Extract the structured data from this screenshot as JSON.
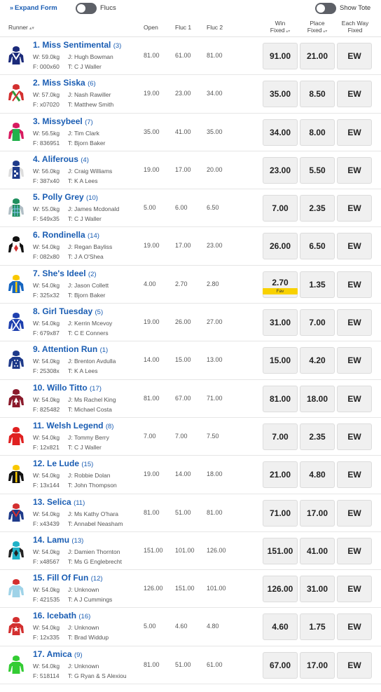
{
  "toolbar": {
    "expand_form_label": "Expand Form",
    "flucs_label": "Flucs",
    "show_tote_label": "Show Tote"
  },
  "headers": {
    "runner": "Runner",
    "open": "Open",
    "fluc1": "Fluc 1",
    "fluc2": "Fluc 2",
    "win_line1": "Win",
    "win_line2": "Fixed",
    "place_line1": "Place",
    "place_line2": "Fixed",
    "ew_line1": "Each Way",
    "ew_line2": "Fixed"
  },
  "runners": [
    {
      "name": "1. Miss Sentimental",
      "barrier": "(3)",
      "weight": "W: 59.0kg",
      "jockey": "J: Hugh Bowman",
      "form": "F: 000x60",
      "trainer": "T: C J Waller",
      "open": "81.00",
      "fluc1": "61.00",
      "fluc2": "81.00",
      "win": "91.00",
      "place": "21.00",
      "ew": "EW",
      "fav": "",
      "silk": {
        "body": "#1b2a7a",
        "sleeve": "#1b2a7a",
        "cap": "#1b2a7a",
        "accent": "#ffffff",
        "pattern": "v"
      }
    },
    {
      "name": "2. Miss Siska",
      "barrier": "(6)",
      "weight": "W: 57.0kg",
      "jockey": "J: Nash Rawiller",
      "form": "F: x07020",
      "trainer": "T: Matthew Smith",
      "open": "19.00",
      "fluc1": "23.00",
      "fluc2": "34.00",
      "win": "35.00",
      "place": "8.50",
      "ew": "EW",
      "fav": "",
      "silk": {
        "body": "#ffffff",
        "sleeve": "#d32f2f",
        "cap": "#d32f2f",
        "accent": "#2e9b3a",
        "pattern": "sash"
      }
    },
    {
      "name": "3. Missybeel",
      "barrier": "(7)",
      "weight": "W: 56.5kg",
      "jockey": "J: Tim Clark",
      "form": "F: 836951",
      "trainer": "T: Bjorn Baker",
      "open": "35.00",
      "fluc1": "41.00",
      "fluc2": "35.00",
      "win": "34.00",
      "place": "8.00",
      "ew": "EW",
      "fav": "",
      "silk": {
        "body": "#22b14c",
        "sleeve": "#d81b60",
        "cap": "#d81b60",
        "accent": "#22b14c",
        "pattern": "plain"
      }
    },
    {
      "name": "4. Aliferous",
      "barrier": "(4)",
      "weight": "W: 56.0kg",
      "jockey": "J: Craig Williams",
      "form": "F: 387x40",
      "trainer": "T: K A Lees",
      "open": "19.00",
      "fluc1": "17.00",
      "fluc2": "20.00",
      "win": "23.00",
      "place": "5.50",
      "ew": "EW",
      "fav": "",
      "silk": {
        "body": "#1e3a8a",
        "sleeve": "#dddddd",
        "cap": "#1e3a8a",
        "accent": "#ffffff",
        "pattern": "check"
      }
    },
    {
      "name": "5. Polly Grey",
      "barrier": "(10)",
      "weight": "W: 55.0kg",
      "jockey": "J: James Mcdonald",
      "form": "F: 549x35",
      "trainer": "T: C J Waller",
      "open": "5.00",
      "fluc1": "6.00",
      "fluc2": "6.50",
      "win": "7.00",
      "place": "2.35",
      "ew": "EW",
      "fav": "",
      "silk": {
        "body": "#1f8f5f",
        "sleeve": "#b0bec5",
        "cap": "#1f8f5f",
        "accent": "#90caf9",
        "pattern": "tartan"
      }
    },
    {
      "name": "6. Rondinella",
      "barrier": "(14)",
      "weight": "W: 54.0kg",
      "jockey": "J: Regan Bayliss",
      "form": "F: 082x80",
      "trainer": "T: J A O'Shea",
      "open": "19.00",
      "fluc1": "17.00",
      "fluc2": "23.00",
      "win": "26.00",
      "place": "6.50",
      "ew": "EW",
      "fav": "",
      "silk": {
        "body": "#ffffff",
        "sleeve": "#111111",
        "cap": "#111111",
        "accent": "#d32f2f",
        "pattern": "diamond"
      }
    },
    {
      "name": "7. She's Ideel",
      "barrier": "(2)",
      "weight": "W: 54.0kg",
      "jockey": "J: Jason Collett",
      "form": "F: 325x32",
      "trainer": "T: Bjorn Baker",
      "open": "4.00",
      "fluc1": "2.70",
      "fluc2": "2.80",
      "win": "2.70",
      "place": "1.35",
      "ew": "EW",
      "fav": "Fav",
      "silk": {
        "body": "#1565c0",
        "sleeve": "#1565c0",
        "cap": "#f9c800",
        "accent": "#f9c800",
        "pattern": "stripe"
      }
    },
    {
      "name": "8. Girl Tuesday",
      "barrier": "(5)",
      "weight": "W: 54.0kg",
      "jockey": "J: Kerrin Mcevoy",
      "form": "F: 679x87",
      "trainer": "T: C E Conners",
      "open": "19.00",
      "fluc1": "26.00",
      "fluc2": "27.00",
      "win": "31.00",
      "place": "7.00",
      "ew": "EW",
      "fav": "",
      "silk": {
        "body": "#1e40af",
        "sleeve": "#1e40af",
        "cap": "#1e40af",
        "accent": "#ffffff",
        "pattern": "cross"
      }
    },
    {
      "name": "9. Attention Run",
      "barrier": "(1)",
      "weight": "W: 54.0kg",
      "jockey": "J: Brenton Avdulla",
      "form": "F: 25308x",
      "trainer": "T: K A Lees",
      "open": "14.00",
      "fluc1": "15.00",
      "fluc2": "13.00",
      "win": "15.00",
      "place": "4.20",
      "ew": "EW",
      "fav": "",
      "silk": {
        "body": "#1e3a8a",
        "sleeve": "#1e3a8a",
        "cap": "#1e3a8a",
        "accent": "#ffffff",
        "pattern": "dots"
      }
    },
    {
      "name": "10. Willo Titto",
      "barrier": "(17)",
      "weight": "W: 54.0kg",
      "jockey": "J: Ms Rachel King",
      "form": "F: 825482",
      "trainer": "T: Michael Costa",
      "open": "81.00",
      "fluc1": "67.00",
      "fluc2": "71.00",
      "win": "81.00",
      "place": "18.00",
      "ew": "EW",
      "fav": "",
      "silk": {
        "body": "#8b1a2b",
        "sleeve": "#8b1a2b",
        "cap": "#8b1a2b",
        "accent": "#ffffff",
        "pattern": "tree"
      }
    },
    {
      "name": "11. Welsh Legend",
      "barrier": "(8)",
      "weight": "W: 54.0kg",
      "jockey": "J: Tommy Berry",
      "form": "F: 12x821",
      "trainer": "T: C J Waller",
      "open": "7.00",
      "fluc1": "7.00",
      "fluc2": "7.50",
      "win": "7.00",
      "place": "2.35",
      "ew": "EW",
      "fav": "",
      "silk": {
        "body": "#e02020",
        "sleeve": "#e02020",
        "cap": "#e02020",
        "accent": "#e02020",
        "pattern": "plain"
      }
    },
    {
      "name": "12. Le Lude",
      "barrier": "(15)",
      "weight": "W: 54.0kg",
      "jockey": "J: Robbie Dolan",
      "form": "F: 13x144",
      "trainer": "T: John Thompson",
      "open": "19.00",
      "fluc1": "14.00",
      "fluc2": "18.00",
      "win": "21.00",
      "place": "4.80",
      "ew": "EW",
      "fav": "",
      "silk": {
        "body": "#111111",
        "sleeve": "#111111",
        "cap": "#f9c800",
        "accent": "#f9c800",
        "pattern": "stripe"
      }
    },
    {
      "name": "13. Selica",
      "barrier": "(11)",
      "weight": "W: 54.0kg",
      "jockey": "J: Ms Kathy O'hara",
      "form": "F: x43439",
      "trainer": "T: Annabel Neasham",
      "open": "81.00",
      "fluc1": "51.00",
      "fluc2": "81.00",
      "win": "71.00",
      "place": "17.00",
      "ew": "EW",
      "fav": "",
      "silk": {
        "body": "#1e3a8a",
        "sleeve": "#1e3a8a",
        "cap": "#d32f2f",
        "accent": "#d32f2f",
        "pattern": "v"
      }
    },
    {
      "name": "14. Lamu",
      "barrier": "(13)",
      "weight": "W: 54.0kg",
      "jockey": "J: Damien Thornton",
      "form": "F: x48567",
      "trainer": "T: Ms G Englebrecht",
      "open": "151.00",
      "fluc1": "101.00",
      "fluc2": "126.00",
      "win": "151.00",
      "place": "41.00",
      "ew": "EW",
      "fav": "",
      "silk": {
        "body": "#20b2c8",
        "sleeve": "#222222",
        "cap": "#20b2c8",
        "accent": "#222222",
        "pattern": "diamond"
      }
    },
    {
      "name": "15. Fill Of Fun",
      "barrier": "(12)",
      "weight": "W: 54.0kg",
      "jockey": "J: Unknown",
      "form": "F: 421535",
      "trainer": "T: A J Cummings",
      "open": "126.00",
      "fluc1": "151.00",
      "fluc2": "101.00",
      "win": "126.00",
      "place": "31.00",
      "ew": "EW",
      "fav": "",
      "silk": {
        "body": "#9fd3e8",
        "sleeve": "#9fd3e8",
        "cap": "#d32f2f",
        "accent": "#9fd3e8",
        "pattern": "plain"
      }
    },
    {
      "name": "16. Icebath",
      "barrier": "(16)",
      "weight": "W: 54.0kg",
      "jockey": "J: Unknown",
      "form": "F: 12x335",
      "trainer": "T: Brad Widdup",
      "open": "5.00",
      "fluc1": "4.60",
      "fluc2": "4.80",
      "win": "4.60",
      "place": "1.75",
      "ew": "EW",
      "fav": "",
      "silk": {
        "body": "#d32f2f",
        "sleeve": "#d32f2f",
        "cap": "#d32f2f",
        "accent": "#ffffff",
        "pattern": "star"
      }
    },
    {
      "name": "17. Amica",
      "barrier": "(9)",
      "weight": "W: 54.0kg",
      "jockey": "J: Unknown",
      "form": "F: 518114",
      "trainer": "T: G Ryan & S Alexiou",
      "open": "81.00",
      "fluc1": "51.00",
      "fluc2": "61.00",
      "win": "67.00",
      "place": "17.00",
      "ew": "EW",
      "fav": "",
      "silk": {
        "body": "#33cc33",
        "sleeve": "#33cc33",
        "cap": "#33cc33",
        "accent": "#ffeb3b",
        "pattern": "plain"
      }
    }
  ]
}
